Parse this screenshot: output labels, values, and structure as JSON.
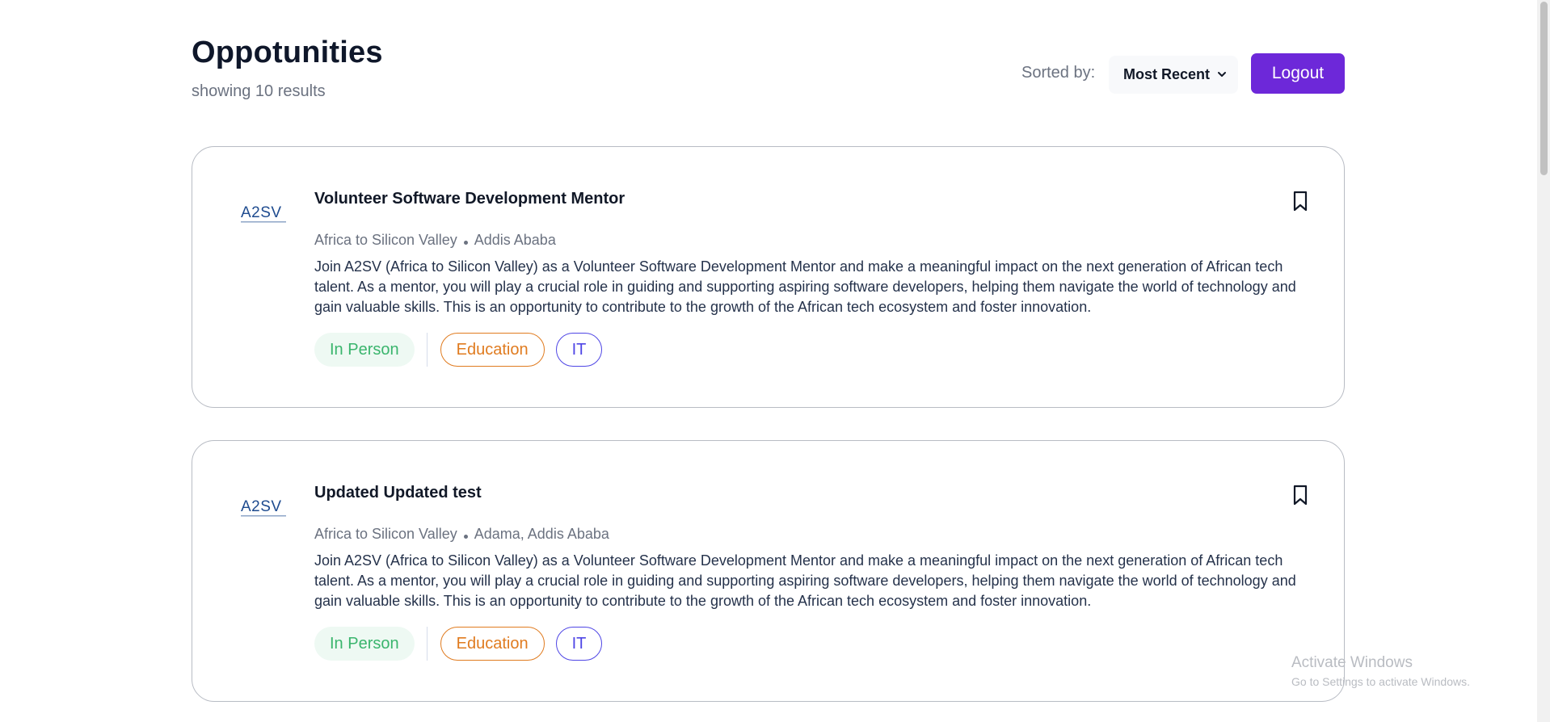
{
  "header": {
    "title": "Oppotunities",
    "results": "showing 10 results",
    "sort_label": "Sorted by:",
    "sort_value": "Most Recent",
    "logout_label": "Logout"
  },
  "cards": [
    {
      "title": "Volunteer Software Development Mentor",
      "company": "Africa to Silicon Valley",
      "location": "Addis Ababa",
      "description": "Join A2SV (Africa to Silicon Valley) as a Volunteer Software Development Mentor and make a meaningful impact on the next generation of African tech talent. As a mentor, you will play a crucial role in guiding and supporting aspiring software developers, helping them navigate the world of technology and gain valuable skills. This is an opportunity to contribute to the growth of the African tech ecosystem and foster innovation.",
      "tags": [
        "In Person",
        "Education",
        "IT"
      ],
      "logo_text": "A2SV"
    },
    {
      "title": "Updated Updated test",
      "company": "Africa to Silicon Valley",
      "location": "Adama, Addis Ababa",
      "description": "Join A2SV (Africa to Silicon Valley) as a Volunteer Software Development Mentor and make a meaningful impact on the next generation of African tech talent. As a mentor, you will play a crucial role in guiding and supporting aspiring software developers, helping them navigate the world of technology and gain valuable skills. This is an opportunity to contribute to the growth of the African tech ecosystem and foster innovation.",
      "tags": [
        "In Person",
        "Education",
        "IT"
      ],
      "logo_text": "A2SV"
    }
  ],
  "watermark": {
    "line1": "Activate Windows",
    "line2": "Go to Settings to activate Windows."
  },
  "colors": {
    "accent": "#6d28d9",
    "in_person": "#3ab56d",
    "education": "#e07b1f",
    "it": "#4f46e5"
  }
}
